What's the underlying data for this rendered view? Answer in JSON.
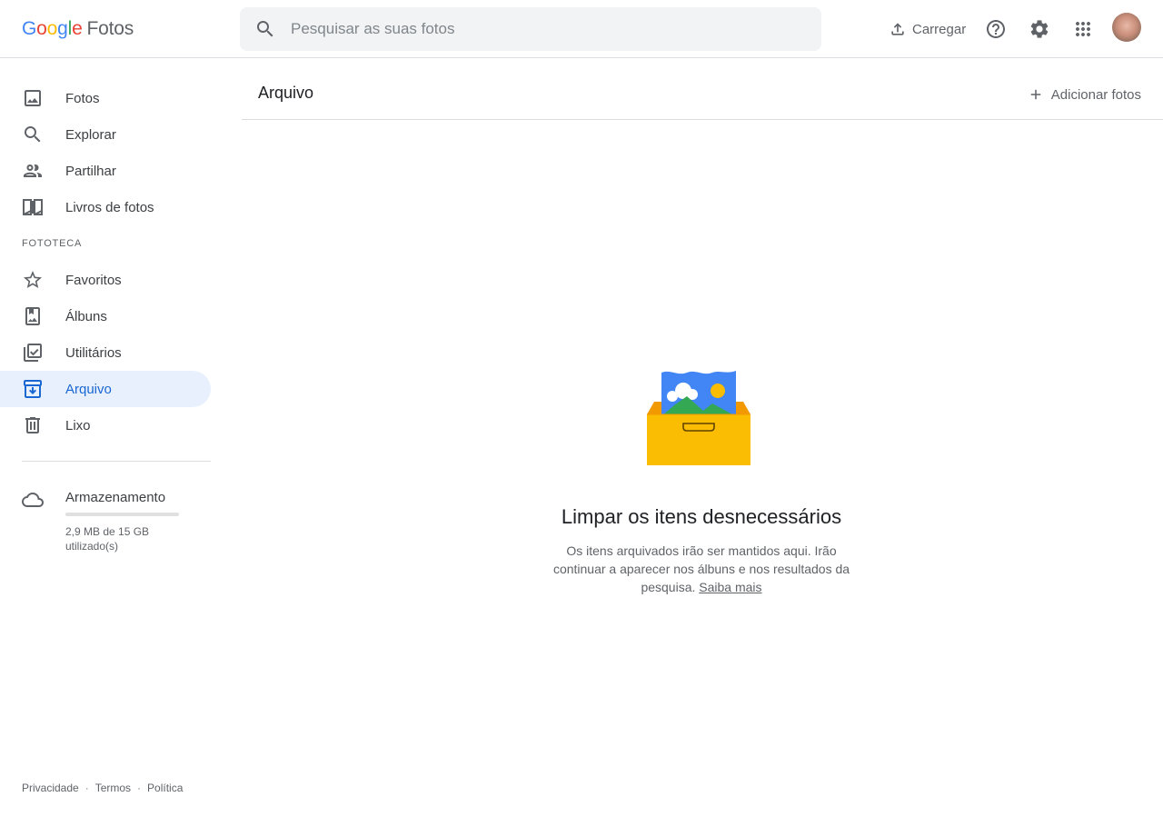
{
  "header": {
    "logo_word": [
      "G",
      "o",
      "o",
      "g",
      "l",
      "e"
    ],
    "product_name": "Fotos",
    "search_placeholder": "Pesquisar as suas fotos",
    "upload_label": "Carregar",
    "icons": {
      "search": "search-icon",
      "upload": "upload-icon",
      "help": "help-icon",
      "settings": "gear-icon",
      "apps": "apps-grid-icon"
    }
  },
  "sidebar": {
    "items": [
      {
        "label": "Fotos",
        "icon": "photo-icon"
      },
      {
        "label": "Explorar",
        "icon": "search-icon"
      },
      {
        "label": "Partilhar",
        "icon": "people-icon"
      },
      {
        "label": "Livros de fotos",
        "icon": "book-icon"
      }
    ],
    "section_label": "FOTOTECA",
    "library_items": [
      {
        "label": "Favoritos",
        "icon": "star-icon"
      },
      {
        "label": "Álbuns",
        "icon": "album-icon"
      },
      {
        "label": "Utilitários",
        "icon": "utilities-icon"
      },
      {
        "label": "Arquivo",
        "icon": "archive-icon",
        "active": true
      },
      {
        "label": "Lixo",
        "icon": "trash-icon"
      }
    ],
    "storage": {
      "title": "Armazenamento",
      "usage_text": "2,9 MB de 15 GB utilizado(s)",
      "used_fraction": 0.0002,
      "icon": "cloud-icon"
    },
    "footer": {
      "privacy": "Privacidade",
      "terms": "Termos",
      "policy": "Política",
      "separator": "·"
    }
  },
  "main": {
    "title": "Arquivo",
    "add_photos_label": "Adicionar fotos",
    "empty_state": {
      "title": "Limpar os itens desnecessários",
      "description": "Os itens arquivados irão ser mantidos aqui. Irão continuar a aparecer nos álbuns e nos resultados da pesquisa.",
      "link": "Saiba mais"
    }
  },
  "colors": {
    "accent_blue": "#1967d2",
    "active_bg": "#e8f0fe",
    "search_bg": "#f1f3f4",
    "box_yellow": "#fbbc04",
    "box_orange": "#f29900"
  }
}
